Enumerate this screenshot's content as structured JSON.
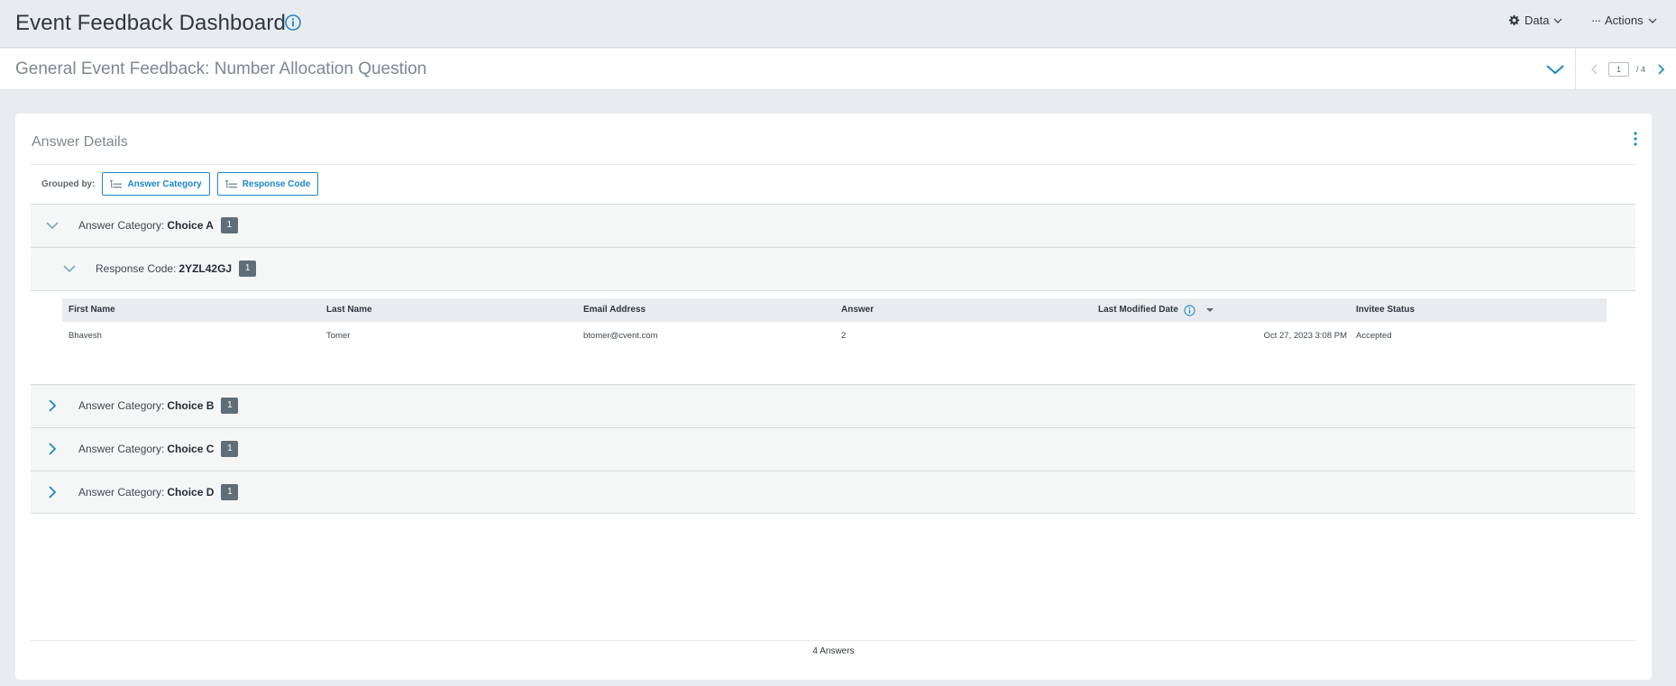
{
  "header": {
    "title": "Event Feedback Dashboard",
    "data_menu_label": "Data",
    "actions_menu_label": "Actions"
  },
  "subheader": {
    "title": "General Event Feedback: Number Allocation Question",
    "pager": {
      "current": "1",
      "total": "/ 4"
    }
  },
  "card": {
    "title": "Answer Details",
    "grouped_by_label": "Grouped by:",
    "groupings": [
      "Answer Category",
      "Response Code"
    ],
    "groups": [
      {
        "label": "Answer Category:",
        "value": "Choice A",
        "count": "1",
        "expanded": true
      },
      {
        "label": "Answer Category:",
        "value": "Choice B",
        "count": "1",
        "expanded": false
      },
      {
        "label": "Answer Category:",
        "value": "Choice C",
        "count": "1",
        "expanded": false
      },
      {
        "label": "Answer Category:",
        "value": "Choice D",
        "count": "1",
        "expanded": false
      }
    ],
    "subgroup": {
      "label": "Response Code:",
      "value": "2YZL42GJ",
      "count": "1"
    },
    "table": {
      "columns": [
        "First Name",
        "Last Name",
        "Email Address",
        "Answer",
        "Last Modified Date",
        "Invitee Status"
      ],
      "rows": [
        [
          "Bhavesh",
          "Tomer",
          "btomer@cvent.com",
          "2",
          "Oct 27, 2023 3:08 PM",
          "Accepted"
        ]
      ]
    },
    "footer": "4 Answers"
  },
  "colors": {
    "accent": "#1d87c8",
    "badge": "#5f6e78",
    "background": "#e9ecee"
  }
}
